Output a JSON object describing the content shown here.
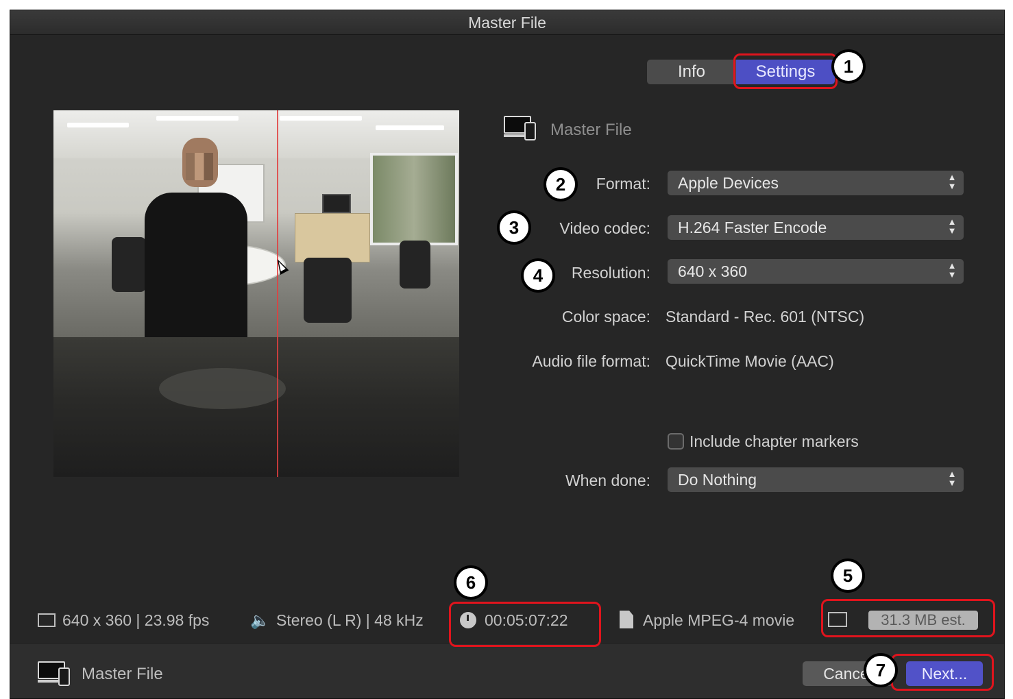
{
  "window": {
    "title": "Master File"
  },
  "tabs": [
    {
      "label": "Info"
    },
    {
      "label": "Settings",
      "selected": true
    }
  ],
  "destination": {
    "name": "Master File",
    "icon": "computer-and-device-icon"
  },
  "settings": {
    "format": {
      "label": "Format:",
      "value": "Apple Devices"
    },
    "video_codec": {
      "label": "Video codec:",
      "value": "H.264 Faster Encode"
    },
    "resolution": {
      "label": "Resolution:",
      "value": "640 x 360"
    },
    "color_space": {
      "label": "Color space:",
      "value": "Standard - Rec. 601 (NTSC)"
    },
    "audio_format": {
      "label": "Audio file format:",
      "value": "QuickTime Movie (AAC)"
    },
    "chapter_markers": {
      "label": "Include chapter markers",
      "checked": false
    },
    "when_done": {
      "label": "When done:",
      "value": "Do Nothing"
    }
  },
  "status_bar": {
    "video": "640 x 360 | 23.98 fps",
    "audio": "Stereo (L R) | 48 kHz",
    "duration": "00:05:07:22",
    "file_type": "Apple MPEG-4 movie",
    "size": "31.3 MB est."
  },
  "footer": {
    "destination_name": "Master File",
    "cancel_label": "Cancel",
    "next_label": "Next..."
  },
  "callouts": [
    "1",
    "2",
    "3",
    "4",
    "5",
    "6",
    "7"
  ],
  "colors": {
    "accent": "#5152c8",
    "callout_outline": "#e0141d",
    "background": "#262626"
  }
}
